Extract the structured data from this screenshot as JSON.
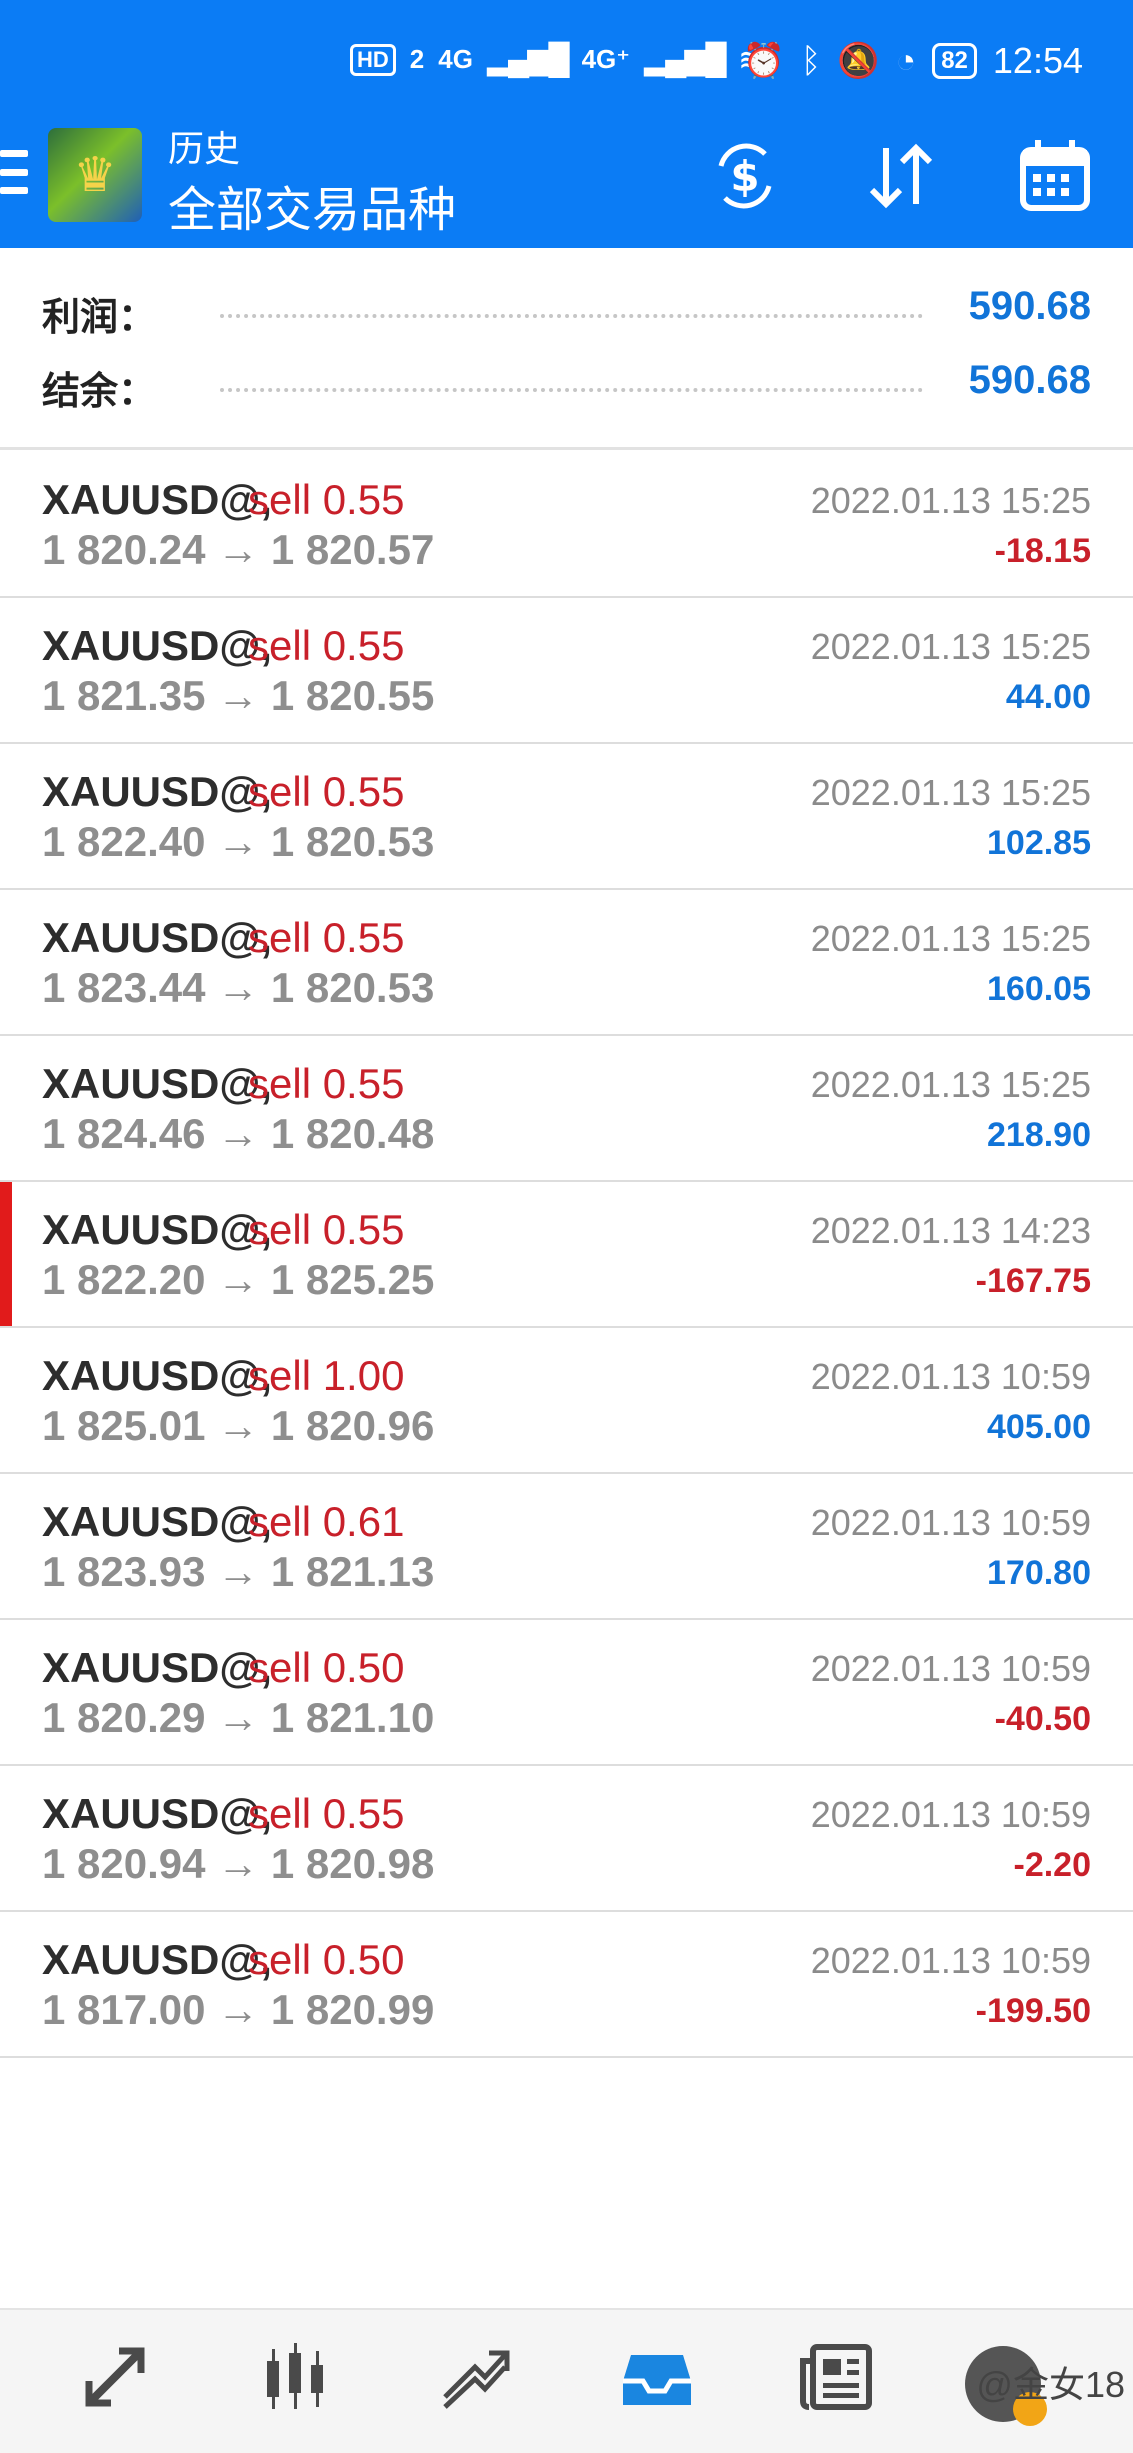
{
  "status_bar": {
    "hd": "HD",
    "sim": "2",
    "net1": "4G",
    "net2": "4G⁺",
    "battery": "82",
    "time": "12:54"
  },
  "app_bar": {
    "title": "历史",
    "subtitle": "全部交易品种"
  },
  "summary": {
    "profit_label": "利润：",
    "profit_value": "590.68",
    "balance_label": "结余：",
    "balance_value": "590.68"
  },
  "trades": [
    {
      "symbol": "XAUUSD@,",
      "side": "sell 0.55",
      "prices": "1 820.24 → 1 820.57",
      "time": "2022.01.13 15:25",
      "pnl": "-18.15"
    },
    {
      "symbol": "XAUUSD@,",
      "side": "sell 0.55",
      "prices": "1 821.35 → 1 820.55",
      "time": "2022.01.13 15:25",
      "pnl": "44.00"
    },
    {
      "symbol": "XAUUSD@,",
      "side": "sell 0.55",
      "prices": "1 822.40 → 1 820.53",
      "time": "2022.01.13 15:25",
      "pnl": "102.85"
    },
    {
      "symbol": "XAUUSD@,",
      "side": "sell 0.55",
      "prices": "1 823.44 → 1 820.53",
      "time": "2022.01.13 15:25",
      "pnl": "160.05"
    },
    {
      "symbol": "XAUUSD@,",
      "side": "sell 0.55",
      "prices": "1 824.46 → 1 820.48",
      "time": "2022.01.13 15:25",
      "pnl": "218.90"
    },
    {
      "symbol": "XAUUSD@,",
      "side": "sell 0.55",
      "prices": "1 822.20 → 1 825.25",
      "time": "2022.01.13 14:23",
      "pnl": "-167.75"
    },
    {
      "symbol": "XAUUSD@,",
      "side": "sell 1.00",
      "prices": "1 825.01 → 1 820.96",
      "time": "2022.01.13 10:59",
      "pnl": "405.00"
    },
    {
      "symbol": "XAUUSD@,",
      "side": "sell 0.61",
      "prices": "1 823.93 → 1 821.13",
      "time": "2022.01.13 10:59",
      "pnl": "170.80"
    },
    {
      "symbol": "XAUUSD@,",
      "side": "sell 0.50",
      "prices": "1 820.29 → 1 821.10",
      "time": "2022.01.13 10:59",
      "pnl": "-40.50"
    },
    {
      "symbol": "XAUUSD@,",
      "side": "sell 0.55",
      "prices": "1 820.94 → 1 820.98",
      "time": "2022.01.13 10:59",
      "pnl": "-2.20"
    },
    {
      "symbol": "XAUUSD@,",
      "side": "sell 0.50",
      "prices": "1 817.00 → 1 820.99",
      "time": "2022.01.13 10:59",
      "pnl": "-199.50"
    }
  ],
  "bottom_nav": {
    "items": [
      "quotes-icon",
      "chart-icon",
      "trade-icon",
      "history-icon",
      "news-icon"
    ],
    "active": "history-icon",
    "watermark": "@金女18"
  },
  "colors": {
    "accent": "#0b7cf5",
    "profit_positive": "#1174d8",
    "profit_negative": "#c8202a"
  }
}
